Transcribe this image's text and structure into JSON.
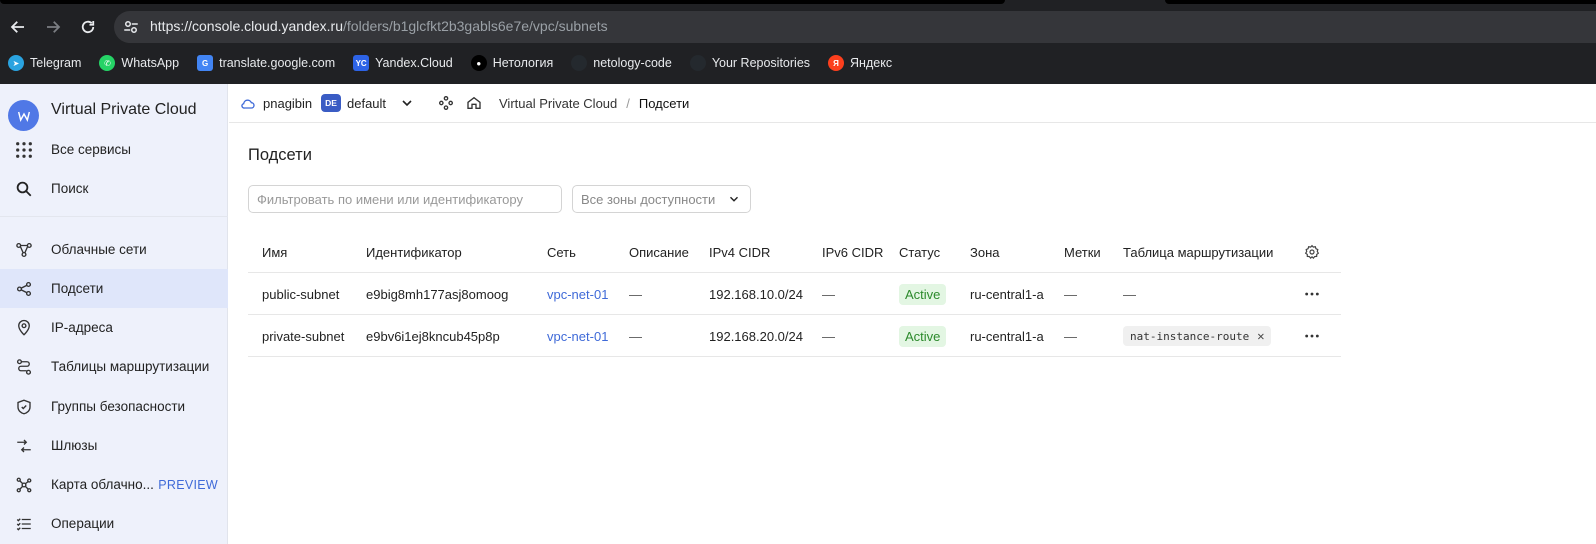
{
  "browser": {
    "url_host": "https://console.cloud.yandex.ru",
    "url_path": "/folders/b1glcfkt2b3gabls6e7e/vpc/subnets",
    "bookmarks": [
      {
        "label": "Telegram",
        "icon": "telegram-icon",
        "color": "#2aa3e0"
      },
      {
        "label": "WhatsApp",
        "icon": "whatsapp-icon",
        "color": "#25d366"
      },
      {
        "label": "translate.google.com",
        "icon": "google-translate-icon",
        "color": "#4285f4"
      },
      {
        "label": "Yandex.Cloud",
        "icon": "yandex-cloud-icon",
        "color": "#2d63e6"
      },
      {
        "label": "Нетология",
        "icon": "netology-icon",
        "color": "#000000"
      },
      {
        "label": "netology-code",
        "icon": "github-icon",
        "color": "#24292e"
      },
      {
        "label": "Your Repositories",
        "icon": "github-icon",
        "color": "#24292e"
      },
      {
        "label": "Яндекс",
        "icon": "yandex-icon",
        "color": "#fc3f1d"
      }
    ]
  },
  "sidebar": {
    "title": "Virtual Private Cloud",
    "top_items": [
      {
        "label": "Все сервисы",
        "icon": "grid-icon"
      },
      {
        "label": "Поиск",
        "icon": "search-icon"
      }
    ],
    "items": [
      {
        "label": "Облачные сети",
        "icon": "network-icon"
      },
      {
        "label": "Подсети",
        "icon": "subnets-icon",
        "active": true
      },
      {
        "label": "IP-адреса",
        "icon": "location-pin-icon"
      },
      {
        "label": "Таблицы маршрутизации",
        "icon": "route-icon"
      },
      {
        "label": "Группы безопасности",
        "icon": "shield-icon"
      },
      {
        "label": "Шлюзы",
        "icon": "gateway-icon"
      },
      {
        "label": "Карта облачно...",
        "icon": "map-icon",
        "badge": "PREVIEW"
      },
      {
        "label": "Операции",
        "icon": "list-icon"
      }
    ]
  },
  "header": {
    "user": "pnagibin",
    "folder_badge": "DE",
    "folder": "default",
    "breadcrumb": [
      "Virtual Private Cloud",
      "Подсети"
    ]
  },
  "main": {
    "title": "Подсети",
    "filter_placeholder": "Фильтровать по имени или идентификатору",
    "zone_select": "Все зоны доступности",
    "columns": [
      "Имя",
      "Идентификатор",
      "Сеть",
      "Описание",
      "IPv4 CIDR",
      "IPv6 CIDR",
      "Статус",
      "Зона",
      "Метки",
      "Таблица маршрутизации"
    ],
    "rows": [
      {
        "name": "public-subnet",
        "id": "e9big8mh177asj8omoog",
        "network": "vpc-net-01",
        "description": "—",
        "ipv4": "192.168.10.0/24",
        "ipv6": "—",
        "status": "Active",
        "zone": "ru-central1-a",
        "labels": "—",
        "route_table": "—"
      },
      {
        "name": "private-subnet",
        "id": "e9bv6i1ej8kncub45p8p",
        "network": "vpc-net-01",
        "description": "—",
        "ipv4": "192.168.20.0/24",
        "ipv6": "—",
        "status": "Active",
        "zone": "ru-central1-a",
        "labels": "—",
        "route_table_tag": "nat-instance-route"
      }
    ]
  },
  "colors": {
    "accent": "#3f6ad8",
    "sidebar_bg": "#eef1fb",
    "sidebar_active": "#dfe6fa",
    "status_active_bg": "#e3f6e3",
    "status_active_fg": "#2c8a2c"
  }
}
